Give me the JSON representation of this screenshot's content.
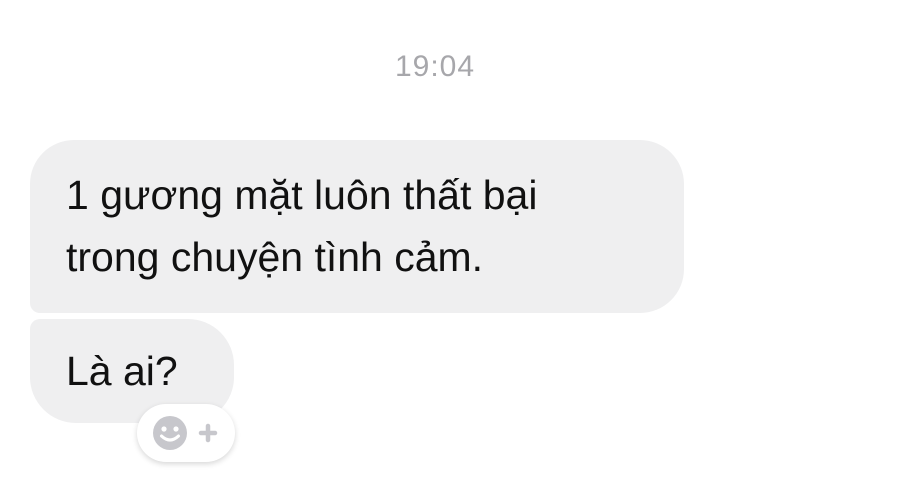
{
  "chat": {
    "timestamp": "19:04",
    "messages": [
      {
        "lines": [
          "1 gương mặt luôn thất bại",
          "trong chuyện tình cảm."
        ]
      },
      {
        "lines": [
          "Là ai?"
        ]
      }
    ],
    "reaction_button": {
      "icon": "smiley-plus-icon"
    }
  },
  "colors": {
    "bubble_background": "#efeff0",
    "timestamp_text": "#a7a7ab",
    "message_text": "#111111",
    "reaction_icon": "#c7c7cc"
  }
}
